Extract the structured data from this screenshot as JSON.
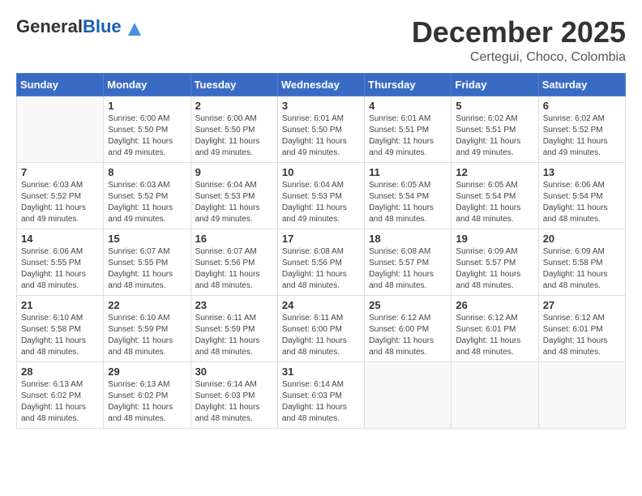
{
  "header": {
    "logo_general": "General",
    "logo_blue": "Blue",
    "month_title": "December 2025",
    "location": "Certegui, Choco, Colombia"
  },
  "days_of_week": [
    "Sunday",
    "Monday",
    "Tuesday",
    "Wednesday",
    "Thursday",
    "Friday",
    "Saturday"
  ],
  "weeks": [
    [
      {
        "day": "",
        "info": ""
      },
      {
        "day": "1",
        "info": "Sunrise: 6:00 AM\nSunset: 5:50 PM\nDaylight: 11 hours\nand 49 minutes."
      },
      {
        "day": "2",
        "info": "Sunrise: 6:00 AM\nSunset: 5:50 PM\nDaylight: 11 hours\nand 49 minutes."
      },
      {
        "day": "3",
        "info": "Sunrise: 6:01 AM\nSunset: 5:50 PM\nDaylight: 11 hours\nand 49 minutes."
      },
      {
        "day": "4",
        "info": "Sunrise: 6:01 AM\nSunset: 5:51 PM\nDaylight: 11 hours\nand 49 minutes."
      },
      {
        "day": "5",
        "info": "Sunrise: 6:02 AM\nSunset: 5:51 PM\nDaylight: 11 hours\nand 49 minutes."
      },
      {
        "day": "6",
        "info": "Sunrise: 6:02 AM\nSunset: 5:52 PM\nDaylight: 11 hours\nand 49 minutes."
      }
    ],
    [
      {
        "day": "7",
        "info": "Sunrise: 6:03 AM\nSunset: 5:52 PM\nDaylight: 11 hours\nand 49 minutes."
      },
      {
        "day": "8",
        "info": "Sunrise: 6:03 AM\nSunset: 5:52 PM\nDaylight: 11 hours\nand 49 minutes."
      },
      {
        "day": "9",
        "info": "Sunrise: 6:04 AM\nSunset: 5:53 PM\nDaylight: 11 hours\nand 49 minutes."
      },
      {
        "day": "10",
        "info": "Sunrise: 6:04 AM\nSunset: 5:53 PM\nDaylight: 11 hours\nand 49 minutes."
      },
      {
        "day": "11",
        "info": "Sunrise: 6:05 AM\nSunset: 5:54 PM\nDaylight: 11 hours\nand 48 minutes."
      },
      {
        "day": "12",
        "info": "Sunrise: 6:05 AM\nSunset: 5:54 PM\nDaylight: 11 hours\nand 48 minutes."
      },
      {
        "day": "13",
        "info": "Sunrise: 6:06 AM\nSunset: 5:54 PM\nDaylight: 11 hours\nand 48 minutes."
      }
    ],
    [
      {
        "day": "14",
        "info": "Sunrise: 6:06 AM\nSunset: 5:55 PM\nDaylight: 11 hours\nand 48 minutes."
      },
      {
        "day": "15",
        "info": "Sunrise: 6:07 AM\nSunset: 5:55 PM\nDaylight: 11 hours\nand 48 minutes."
      },
      {
        "day": "16",
        "info": "Sunrise: 6:07 AM\nSunset: 5:56 PM\nDaylight: 11 hours\nand 48 minutes."
      },
      {
        "day": "17",
        "info": "Sunrise: 6:08 AM\nSunset: 5:56 PM\nDaylight: 11 hours\nand 48 minutes."
      },
      {
        "day": "18",
        "info": "Sunrise: 6:08 AM\nSunset: 5:57 PM\nDaylight: 11 hours\nand 48 minutes."
      },
      {
        "day": "19",
        "info": "Sunrise: 6:09 AM\nSunset: 5:57 PM\nDaylight: 11 hours\nand 48 minutes."
      },
      {
        "day": "20",
        "info": "Sunrise: 6:09 AM\nSunset: 5:58 PM\nDaylight: 11 hours\nand 48 minutes."
      }
    ],
    [
      {
        "day": "21",
        "info": "Sunrise: 6:10 AM\nSunset: 5:58 PM\nDaylight: 11 hours\nand 48 minutes."
      },
      {
        "day": "22",
        "info": "Sunrise: 6:10 AM\nSunset: 5:59 PM\nDaylight: 11 hours\nand 48 minutes."
      },
      {
        "day": "23",
        "info": "Sunrise: 6:11 AM\nSunset: 5:59 PM\nDaylight: 11 hours\nand 48 minutes."
      },
      {
        "day": "24",
        "info": "Sunrise: 6:11 AM\nSunset: 6:00 PM\nDaylight: 11 hours\nand 48 minutes."
      },
      {
        "day": "25",
        "info": "Sunrise: 6:12 AM\nSunset: 6:00 PM\nDaylight: 11 hours\nand 48 minutes."
      },
      {
        "day": "26",
        "info": "Sunrise: 6:12 AM\nSunset: 6:01 PM\nDaylight: 11 hours\nand 48 minutes."
      },
      {
        "day": "27",
        "info": "Sunrise: 6:12 AM\nSunset: 6:01 PM\nDaylight: 11 hours\nand 48 minutes."
      }
    ],
    [
      {
        "day": "28",
        "info": "Sunrise: 6:13 AM\nSunset: 6:02 PM\nDaylight: 11 hours\nand 48 minutes."
      },
      {
        "day": "29",
        "info": "Sunrise: 6:13 AM\nSunset: 6:02 PM\nDaylight: 11 hours\nand 48 minutes."
      },
      {
        "day": "30",
        "info": "Sunrise: 6:14 AM\nSunset: 6:03 PM\nDaylight: 11 hours\nand 48 minutes."
      },
      {
        "day": "31",
        "info": "Sunrise: 6:14 AM\nSunset: 6:03 PM\nDaylight: 11 hours\nand 48 minutes."
      },
      {
        "day": "",
        "info": ""
      },
      {
        "day": "",
        "info": ""
      },
      {
        "day": "",
        "info": ""
      }
    ]
  ]
}
